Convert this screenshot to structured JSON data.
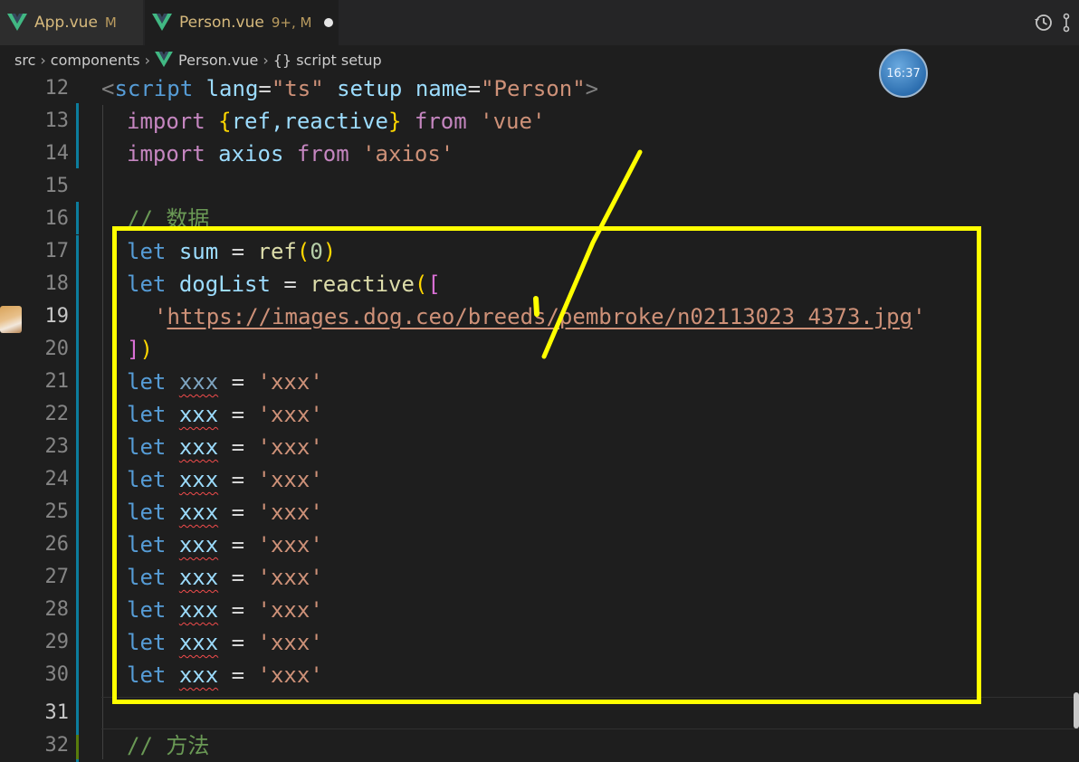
{
  "tabs": [
    {
      "name": "App.vue",
      "status": "M",
      "active": false
    },
    {
      "name": "Person.vue",
      "status": "9+, M",
      "active": true
    }
  ],
  "breadcrumb": {
    "items": [
      "src",
      "components",
      "Person.vue",
      "{} script setup"
    ]
  },
  "clock": {
    "time": "16:37"
  },
  "annotation": {
    "color": "#ffff00"
  },
  "colors": {
    "keyword": "#569cd6",
    "import": "#c586c0",
    "variable": "#9cdcfe",
    "function": "#dcdcaa",
    "string": "#ce9178",
    "comment": "#6a9955",
    "background": "#1e1e1e"
  },
  "icons": [
    "vue-icon",
    "history-icon",
    "chevron-right-icon",
    "avatar-dog-icon"
  ],
  "code": {
    "line_numbers": [
      "12",
      "13",
      "14",
      "15",
      "16",
      "17",
      "18",
      "19",
      "20",
      "21",
      "22",
      "23",
      "24",
      "25",
      "26",
      "27",
      "28",
      "29",
      "30",
      "31",
      "32"
    ],
    "l12": {
      "lt": "<",
      "tag": "script",
      "a1": "lang",
      "eq1": "=",
      "v1": "\"ts\"",
      "a2": "setup",
      "a3": "name",
      "eq2": "=",
      "v2": "\"Person\"",
      "gt": ">"
    },
    "l13": {
      "kw": "import",
      "open": "{",
      "names": "ref,reactive",
      "close": "}",
      "from": "from",
      "mod": "'vue'"
    },
    "l14": {
      "kw": "import",
      "name": "axios",
      "from": "from",
      "mod": "'axios'"
    },
    "l16": {
      "comment": "// 数据"
    },
    "l17": {
      "kw": "let",
      "name": "sum",
      "eq": "=",
      "fn": "ref",
      "arg": "0"
    },
    "l18": {
      "kw": "let",
      "name": "dogList",
      "eq": "=",
      "fn": "reactive",
      "open": "[",
      "open_paren": "("
    },
    "l19": {
      "q1": "'",
      "url": "https://images.dog.ceo/breeds/pembroke/n02113023_4373.jpg",
      "q2": "'"
    },
    "l20": {
      "close_bracket": "]",
      "close_paren": ")"
    },
    "xxx_line": {
      "kw": "let",
      "name": "xxx",
      "eq": "=",
      "val": "'xxx'"
    },
    "l32": {
      "comment": "// 方法"
    }
  }
}
